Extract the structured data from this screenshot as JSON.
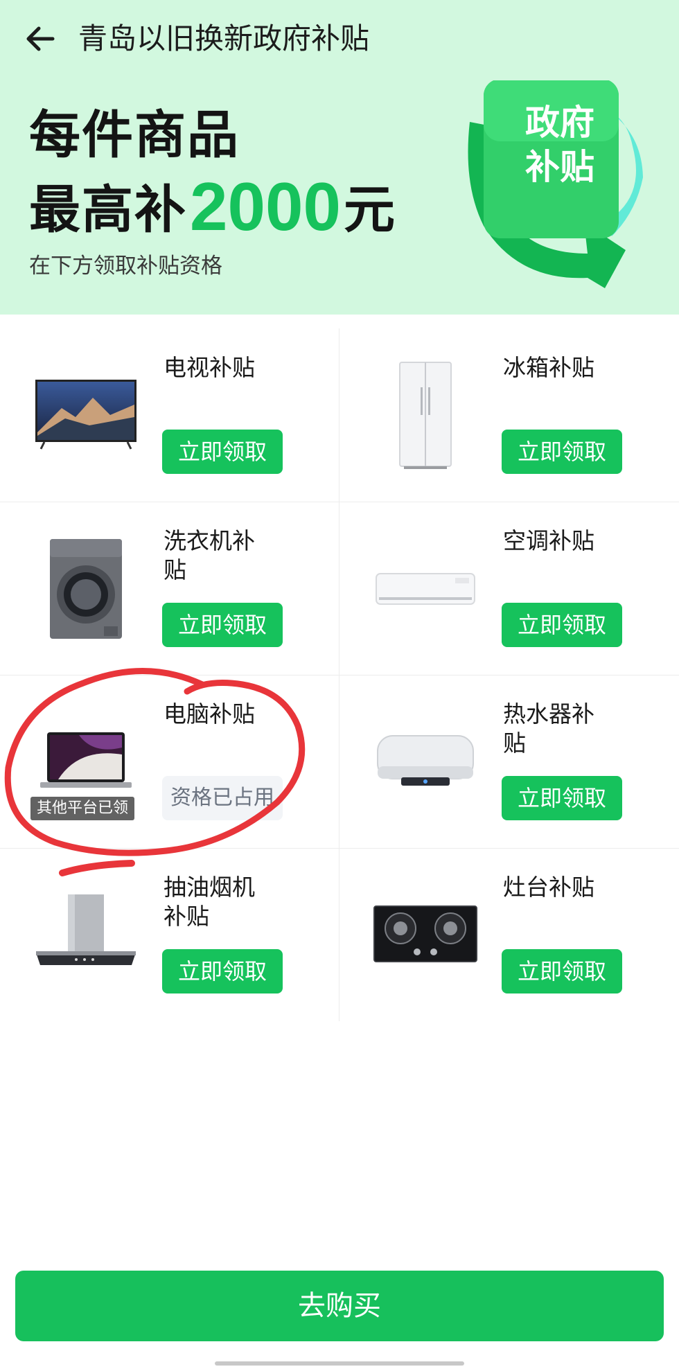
{
  "app": {
    "nav_title": "青岛以旧换新政府补贴",
    "back_icon": "back-arrow-icon"
  },
  "hero": {
    "line1": "每件商品",
    "line2_prefix": "最高补",
    "line2_amount": "2000",
    "line2_suffix": "元",
    "subtitle": "在下方领取补贴资格",
    "badge_line1": "政府",
    "badge_line2": "补贴"
  },
  "colors": {
    "brand_green": "#16c25c",
    "header_bg": "#d2f8df",
    "annotation_red": "#e8353a"
  },
  "items": [
    {
      "label": "电视补贴",
      "button": "立即领取",
      "icon": "tv-icon"
    },
    {
      "label": "冰箱补贴",
      "button": "立即领取",
      "icon": "fridge-icon"
    },
    {
      "label": "洗衣机补贴",
      "button": "立即领取",
      "icon": "washing-machine-icon"
    },
    {
      "label": "空调补贴",
      "button": "立即领取",
      "icon": "air-conditioner-icon"
    },
    {
      "label": "电脑补贴",
      "status": "资格已占用",
      "badge": "其他平台已领",
      "icon": "laptop-icon"
    },
    {
      "label": "热水器补贴",
      "button": "立即领取",
      "icon": "water-heater-icon"
    },
    {
      "label": "抽油烟机补贴",
      "button": "立即领取",
      "icon": "range-hood-icon"
    },
    {
      "label": "灶台补贴",
      "button": "立即领取",
      "icon": "gas-stove-icon"
    }
  ],
  "footer": {
    "buy_button": "去购买"
  }
}
